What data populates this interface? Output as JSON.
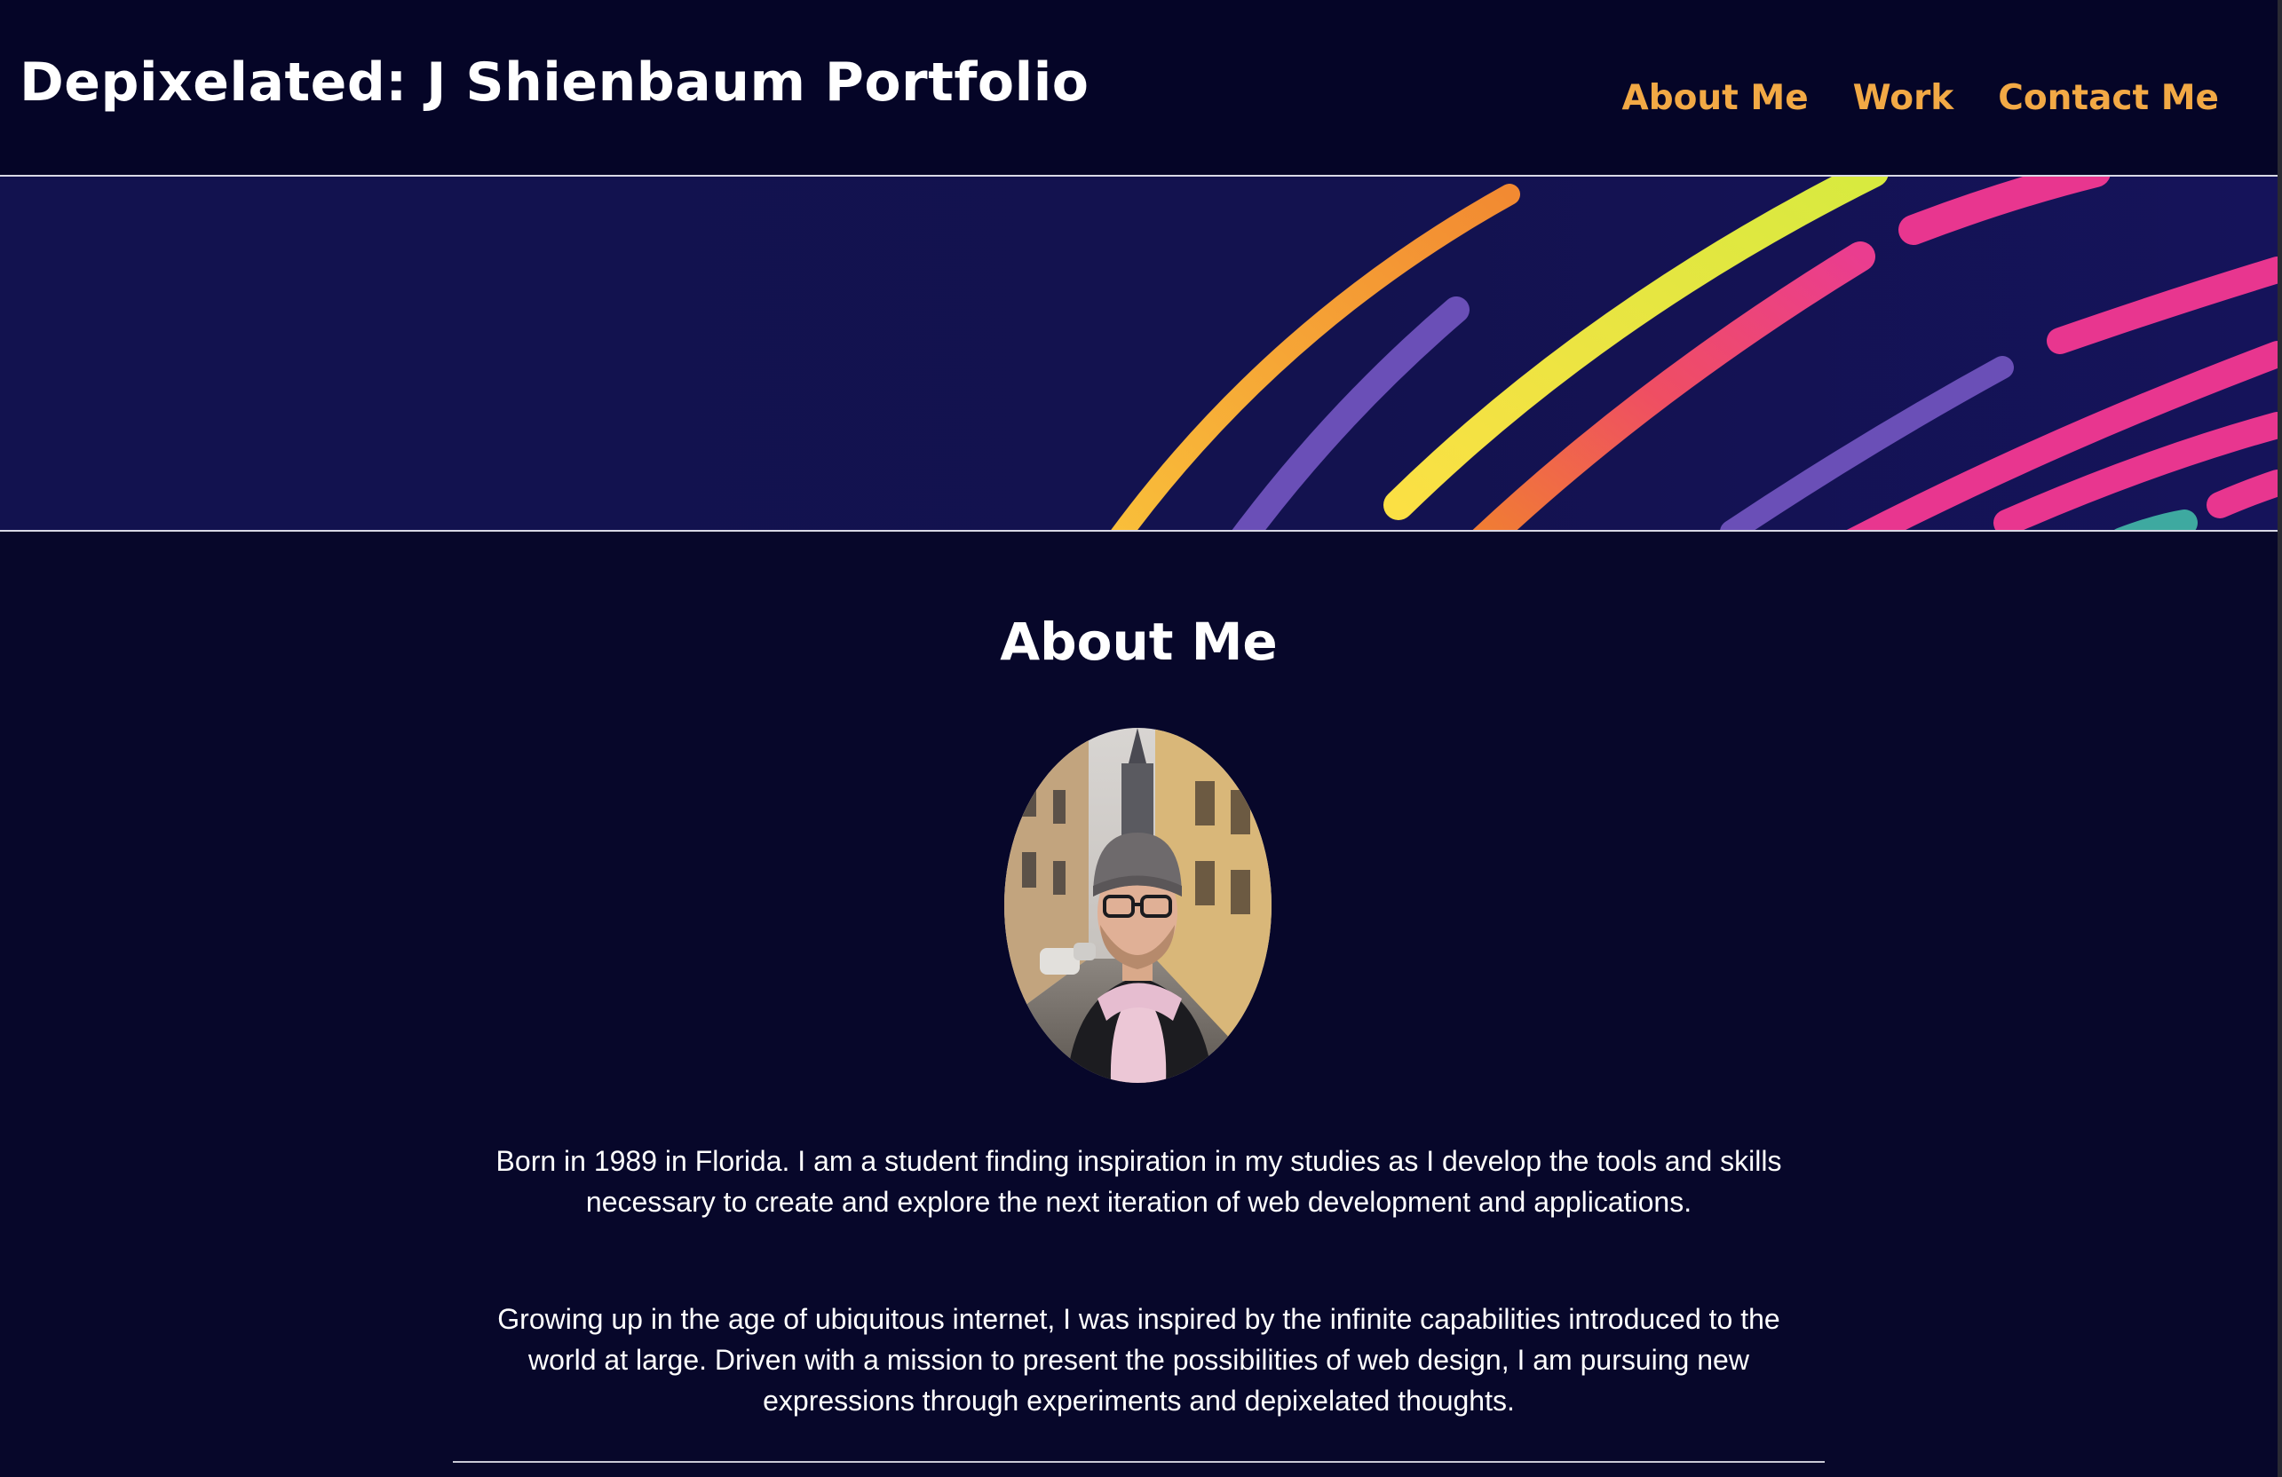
{
  "header": {
    "title": "Depixelated: J Shienbaum Portfolio",
    "nav": [
      {
        "label": "About Me"
      },
      {
        "label": "Work"
      },
      {
        "label": "Contact Me"
      }
    ]
  },
  "hero": {
    "image": "abstract-rainbow-stripes-banner"
  },
  "about": {
    "heading": "About Me",
    "photo": "portrait-photo",
    "paragraphs": [
      "Born in 1989 in Florida. I am a student finding inspiration in my studies as I develop the tools and skills necessary to create and explore the next iteration of web development and applications.",
      "Growing up in the age of ubiquitous internet, I was inspired by the infinite capabilities introduced to the world at large. Driven with a mission to present the possibilities of web design, I am pursuing new expressions through experiments and depixelated thoughts."
    ]
  },
  "colors": {
    "background": "#07072a",
    "header_bg": "#050527",
    "nav_link": "#f2a945",
    "hero_bg": "#12124f"
  }
}
